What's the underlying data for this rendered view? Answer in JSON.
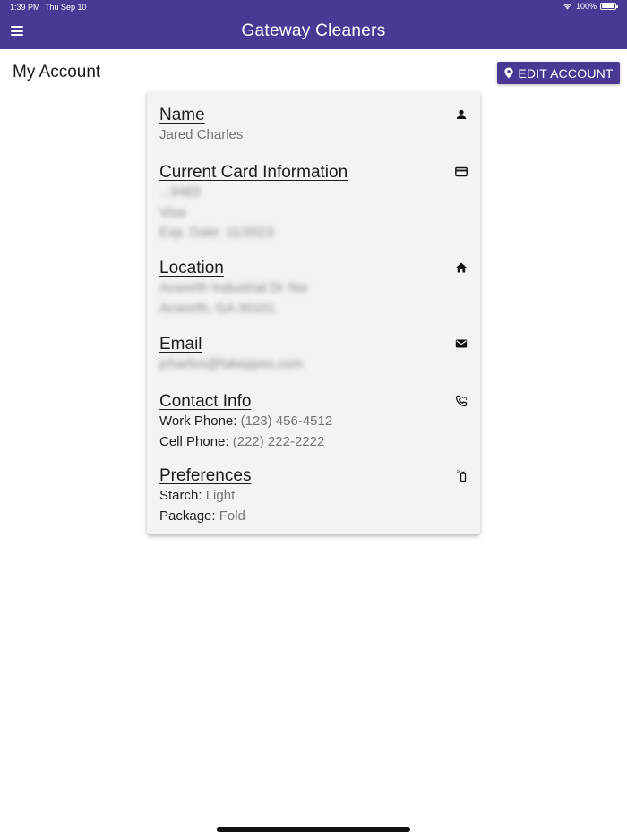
{
  "status_bar": {
    "time": "1:39 PM",
    "date": "Thu Sep 10",
    "battery": "100%"
  },
  "app_bar": {
    "title": "Gateway Cleaners",
    "menu_icon": "hamburger-menu-icon"
  },
  "page": {
    "title": "My Account",
    "edit_button": "EDIT ACCOUNT"
  },
  "sections": {
    "name": {
      "title": "Name",
      "value": "Jared Charles",
      "icon": "person-icon"
    },
    "card": {
      "title": "Current Card Information",
      "line1": "...9483",
      "line2": "Visa",
      "line3": "Exp. Date: 11/2023",
      "icon": "credit-card-icon"
    },
    "location": {
      "title": "Location",
      "line1": "Acworth Industrial Dr Nw",
      "line2": "Acworth, GA 30101",
      "icon": "home-icon"
    },
    "email": {
      "title": "Email",
      "value": "jcharles@fakeppes.com",
      "icon": "mail-icon"
    },
    "contact": {
      "title": "Contact Info",
      "work_label": "Work Phone:",
      "work_value": "(123) 456-4512",
      "cell_label": "Cell Phone:",
      "cell_value": "(222) 222-2222",
      "icon": "phone-dialpad-icon"
    },
    "preferences": {
      "title": "Preferences",
      "starch_label": "Starch:",
      "starch_value": "Light",
      "package_label": "Package:",
      "package_value": "Fold",
      "icon": "spray-bottle-icon"
    }
  },
  "colors": {
    "brand": "#4a3894",
    "card_bg": "#f3f3f3",
    "value_text": "#757575"
  }
}
